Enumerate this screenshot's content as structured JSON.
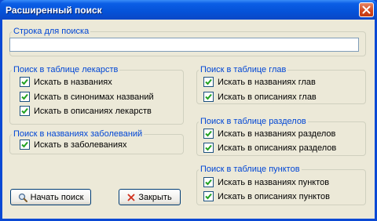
{
  "window": {
    "title": "Расширенный поиск"
  },
  "search": {
    "legend": "Строка для поиска",
    "value": "",
    "placeholder": ""
  },
  "drugs": {
    "legend": "Поиск в таблице лекарств",
    "options": [
      {
        "label": "Искать в названиях",
        "checked": true
      },
      {
        "label": "Искать в синонимах названий",
        "checked": true
      },
      {
        "label": "Искать в описаниях лекарств",
        "checked": true
      }
    ]
  },
  "diseases": {
    "legend": "Поиск в названиях заболеваний",
    "options": [
      {
        "label": "Искать в заболеваниях",
        "checked": true
      }
    ]
  },
  "chapters": {
    "legend": "Поиск в таблице глав",
    "options": [
      {
        "label": "Искать в названиях глав",
        "checked": true
      },
      {
        "label": "Искать в описаниях глав",
        "checked": true
      }
    ]
  },
  "sections": {
    "legend": "Поиск в таблице разделов",
    "options": [
      {
        "label": "Искать в названиях разделов",
        "checked": true
      },
      {
        "label": "Искать в описаниях разделов",
        "checked": true
      }
    ]
  },
  "items": {
    "legend": "Поиск в таблице пунктов",
    "options": [
      {
        "label": "Искать в названиях пунктов",
        "checked": true
      },
      {
        "label": "Искать в описаниях пунктов",
        "checked": true
      }
    ]
  },
  "buttons": {
    "start": "Начать поиск",
    "close": "Закрыть"
  },
  "icons": {
    "start": "magnifier-icon",
    "close": "red-x-icon",
    "window_close": "close-icon"
  },
  "colors": {
    "title_bar": "#0552d8",
    "dialog_bg": "#ece9d8",
    "legend_text": "#0046d5",
    "checkmark": "#21a121"
  }
}
